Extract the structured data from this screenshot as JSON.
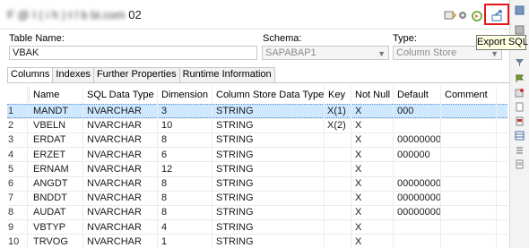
{
  "window": {
    "title_blurred": "F  @ I  (  i h  )   t    l  b  bi.com",
    "title_suffix": "02",
    "export_tooltip": "Export SQL"
  },
  "form": {
    "table_name_label": "Table Name:",
    "table_name_value": "VBAK",
    "schema_label": "Schema:",
    "schema_value": "SAPABAP1",
    "type_label": "Type:",
    "type_value": "Column Store"
  },
  "tabs": [
    "Columns",
    "Indexes",
    "Further Properties",
    "Runtime Information"
  ],
  "grid": {
    "headers": [
      "Name",
      "SQL Data Type",
      "Dimension",
      "Column Store Data Type",
      "Key",
      "Not Null",
      "Default",
      "Comment"
    ],
    "rows": [
      {
        "n": "1",
        "name": "MANDT",
        "sql": "NVARCHAR",
        "dim": "3",
        "cs": "STRING",
        "key": "X(1)",
        "nn": "X",
        "def": "000",
        "comment": ""
      },
      {
        "n": "2",
        "name": "VBELN",
        "sql": "NVARCHAR",
        "dim": "10",
        "cs": "STRING",
        "key": "X(2)",
        "nn": "X",
        "def": "",
        "comment": ""
      },
      {
        "n": "3",
        "name": "ERDAT",
        "sql": "NVARCHAR",
        "dim": "8",
        "cs": "STRING",
        "key": "",
        "nn": "X",
        "def": "00000000",
        "comment": ""
      },
      {
        "n": "4",
        "name": "ERZET",
        "sql": "NVARCHAR",
        "dim": "6",
        "cs": "STRING",
        "key": "",
        "nn": "X",
        "def": "000000",
        "comment": ""
      },
      {
        "n": "5",
        "name": "ERNAM",
        "sql": "NVARCHAR",
        "dim": "12",
        "cs": "STRING",
        "key": "",
        "nn": "X",
        "def": "",
        "comment": ""
      },
      {
        "n": "6",
        "name": "ANGDT",
        "sql": "NVARCHAR",
        "dim": "8",
        "cs": "STRING",
        "key": "",
        "nn": "X",
        "def": "00000000",
        "comment": ""
      },
      {
        "n": "7",
        "name": "BNDDT",
        "sql": "NVARCHAR",
        "dim": "8",
        "cs": "STRING",
        "key": "",
        "nn": "X",
        "def": "00000000",
        "comment": ""
      },
      {
        "n": "8",
        "name": "AUDAT",
        "sql": "NVARCHAR",
        "dim": "8",
        "cs": "STRING",
        "key": "",
        "nn": "X",
        "def": "00000000",
        "comment": ""
      },
      {
        "n": "9",
        "name": "VBTYP",
        "sql": "NVARCHAR",
        "dim": "4",
        "cs": "STRING",
        "key": "",
        "nn": "X",
        "def": "",
        "comment": ""
      },
      {
        "n": "10",
        "name": "TRVOG",
        "sql": "NVARCHAR",
        "dim": "1",
        "cs": "STRING",
        "key": "",
        "nn": "X",
        "def": "",
        "comment": ""
      }
    ]
  },
  "icons": {
    "toolbar": [
      "refresh-icon",
      "circle-icon",
      "run-icon",
      "export-sql-icon"
    ],
    "side": [
      "outline-icon",
      "properties-icon",
      "stack-icon",
      "filter-icon",
      "flag-icon",
      "cube-icon",
      "page-icon",
      "bookmark-icon",
      "table-icon",
      "list-icon",
      "document-icon"
    ]
  },
  "colors": {
    "selection": "#cde8ff",
    "highlight_border": "#e8141a",
    "tooltip_bg": "#ffffe1"
  }
}
